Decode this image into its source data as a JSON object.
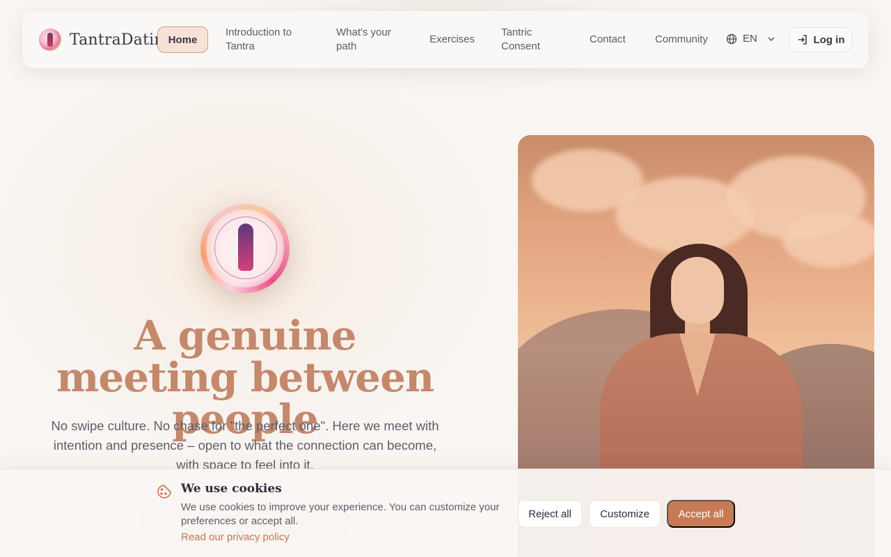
{
  "brand": {
    "name": "TantraDating"
  },
  "nav": {
    "items": [
      {
        "label": "Home",
        "active": true
      },
      {
        "label": "Introduction to Tantra"
      },
      {
        "label": "What's your path"
      },
      {
        "label": "Exercises"
      },
      {
        "label": "Tantric Consent"
      },
      {
        "label": "Contact"
      },
      {
        "label": "Community"
      }
    ],
    "language": "EN",
    "login_label": "Log in"
  },
  "hero": {
    "title": "A genuine meeting between people",
    "subtitle": "No swipe culture. No chase for \"the perfect one\". Here we meet with intention and presence – open to what the connection can become, with space to feel into it."
  },
  "cookie": {
    "title": "We use cookies",
    "text": "We use cookies to improve your experience. You can customize your preferences or accept all.",
    "link": "Read our privacy policy",
    "reject_label": "Reject all",
    "customize_label": "Customize",
    "accept_label": "Accept all"
  },
  "colors": {
    "accent": "#c67b54",
    "title": "#c4896d",
    "background": "#f8f5f2"
  }
}
